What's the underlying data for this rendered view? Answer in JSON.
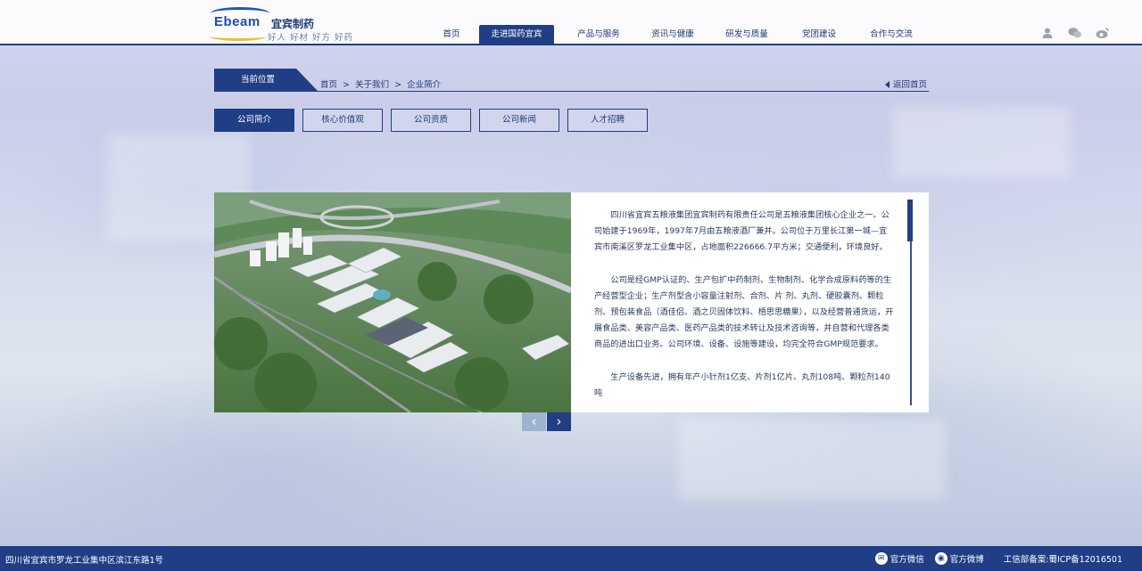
{
  "logo": {
    "en": "Ebeam",
    "cn": "宜宾制药",
    "slogan": "好人 好材 好方 好药"
  },
  "nav": {
    "items": [
      {
        "label": "首页",
        "active": false
      },
      {
        "label": "走进国药宜宾",
        "active": true
      },
      {
        "label": "产品与服务",
        "active": false
      },
      {
        "label": "资讯与健康",
        "active": false
      },
      {
        "label": "研发与质量",
        "active": false
      },
      {
        "label": "党团建设",
        "active": false
      },
      {
        "label": "合作与交流",
        "active": false
      }
    ],
    "icons": [
      "user-icon",
      "wechat-icon",
      "weibo-icon"
    ]
  },
  "position": {
    "label": "当前位置",
    "crumbs": [
      "首页",
      ">",
      "关于我们",
      ">",
      "企业简介"
    ],
    "back": "返回首页"
  },
  "tabs": [
    {
      "label": "公司简介",
      "active": true
    },
    {
      "label": "核心价值观",
      "active": false
    },
    {
      "label": "公司资质",
      "active": false
    },
    {
      "label": "公司新闻",
      "active": false
    },
    {
      "label": "人才招聘",
      "active": false
    }
  ],
  "intro": {
    "paragraphs": [
      "四川省宜宾五粮液集团宜宾制药有限责任公司是五粮液集团核心企业之一。公司始建于1969年，1997年7月由五粮液酒厂兼并。公司位于万里长江第一城—宜宾市南溪区罗龙工业集中区，占地面积226666.7平方米；交通便利，环境良好。",
      "公司是经GMP认证的、生产包扩中药制剂、生物制剂、化学合成原料药等的生产经营型企业；生产剂型含小容量注射剂、合剂、片 剂、丸剂、硬胶囊剂、颗粒剂、预包装食品（酒佳侣、酒之贝固体饮料、梧思思糖果），以及经营普通货运，开展食品类、美容产品类、医药产品类的技术转让及技术咨询等，并自营和代理各类商品的进出口业务。公司环境、设备、设施等建设，均完全符合GMP规范要求。",
      "生产设备先进，拥有年产小针剂1亿支、片剂1亿片、丸剂108吨、颗粒剂140吨"
    ]
  },
  "pager": {
    "prev": "‹",
    "next": "›"
  },
  "footer": {
    "address": "四川省宜宾市罗龙工业集中区滨江东路1号",
    "wechat": "官方微信",
    "weibo": "官方微博",
    "icp": "工信部备案:蜀ICP备12016501"
  },
  "colors": {
    "primary": "#1f3e86",
    "text": "#1f3d78"
  }
}
